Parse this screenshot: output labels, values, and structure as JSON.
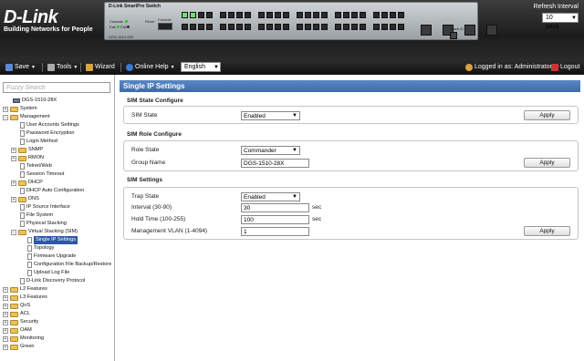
{
  "header": {
    "logo_text": "D-Link",
    "logo_tagline": "Building Networks for People",
    "switch_brand": "D-Link  SmartPro Switch",
    "switch_model": "DGS-1510-28X",
    "console_label": "Console",
    "fan_label": "Fan",
    "fail_label": "Fail",
    "reset_label": "Reset",
    "console_port_label": "Console",
    "stack_id_label": "Stack ID",
    "refresh_label": "Refresh Interval",
    "refresh_value": "10 secs"
  },
  "toolbar": {
    "save": "Save",
    "tools": "Tools",
    "wizard": "Wizard",
    "online_help": "Online Help",
    "language": "English",
    "logged_in": "Logged in as: Administrator, --",
    "logout": "Logout"
  },
  "tree": {
    "search_placeholder": "Fuzzy Search",
    "device": "DGS-1510-28X",
    "items": {
      "system": "System",
      "management": "Management",
      "user_accounts": "User Accounts Settings",
      "password_enc": "Password Encryption",
      "login_method": "Login Method",
      "snmp": "SNMP",
      "rmon": "RMON",
      "telnet_web": "Telnet/Web",
      "session_timeout": "Session Timeout",
      "dhcp": "DHCP",
      "dhcp_auto": "DHCP Auto Configuration",
      "dns": "DNS",
      "ip_source": "IP Source Interface",
      "file_system": "File System",
      "physical_stacking": "Physical Stacking",
      "virtual_stacking": "Virtual Stacking (SIM)",
      "single_ip": "Single IP Settings",
      "topology": "Topology",
      "firmware_upgrade": "Firmware Upgrade",
      "config_backup": "Configuration File Backup/Restore",
      "upload_log": "Upload Log File",
      "dlink_discovery": "D-Link Discovery Protocol",
      "l2": "L2 Features",
      "l3": "L3 Features",
      "qos": "QoS",
      "acl": "ACL",
      "security": "Security",
      "oam": "OAM",
      "monitoring": "Monitoring",
      "green": "Green"
    }
  },
  "main": {
    "title": "Single IP Settings",
    "sim_state_section": {
      "heading": "SIM State Configure",
      "label": "SIM State",
      "value": "Enabled",
      "apply": "Apply"
    },
    "sim_role_section": {
      "heading": "SIM Role Configure",
      "role_label": "Role State",
      "role_value": "Commander",
      "group_label": "Group Name",
      "group_value": "DGS-1510-28X",
      "apply": "Apply"
    },
    "sim_settings_section": {
      "heading": "SIM Settings",
      "trap_label": "Trap State",
      "trap_value": "Enabled",
      "interval_label": "Interval (30-90)",
      "interval_value": "30",
      "interval_unit": "sec",
      "hold_label": "Hold Time (100-255)",
      "hold_value": "100",
      "hold_unit": "sec",
      "vlan_label": "Management VLAN (1-4094)",
      "vlan_value": "1",
      "apply": "Apply"
    }
  },
  "colors": {
    "title_bar": "#4a78b8",
    "header_bg": "#2a2a2a",
    "selected_item": "#2d58a8",
    "port_active": "#6fe06f"
  }
}
